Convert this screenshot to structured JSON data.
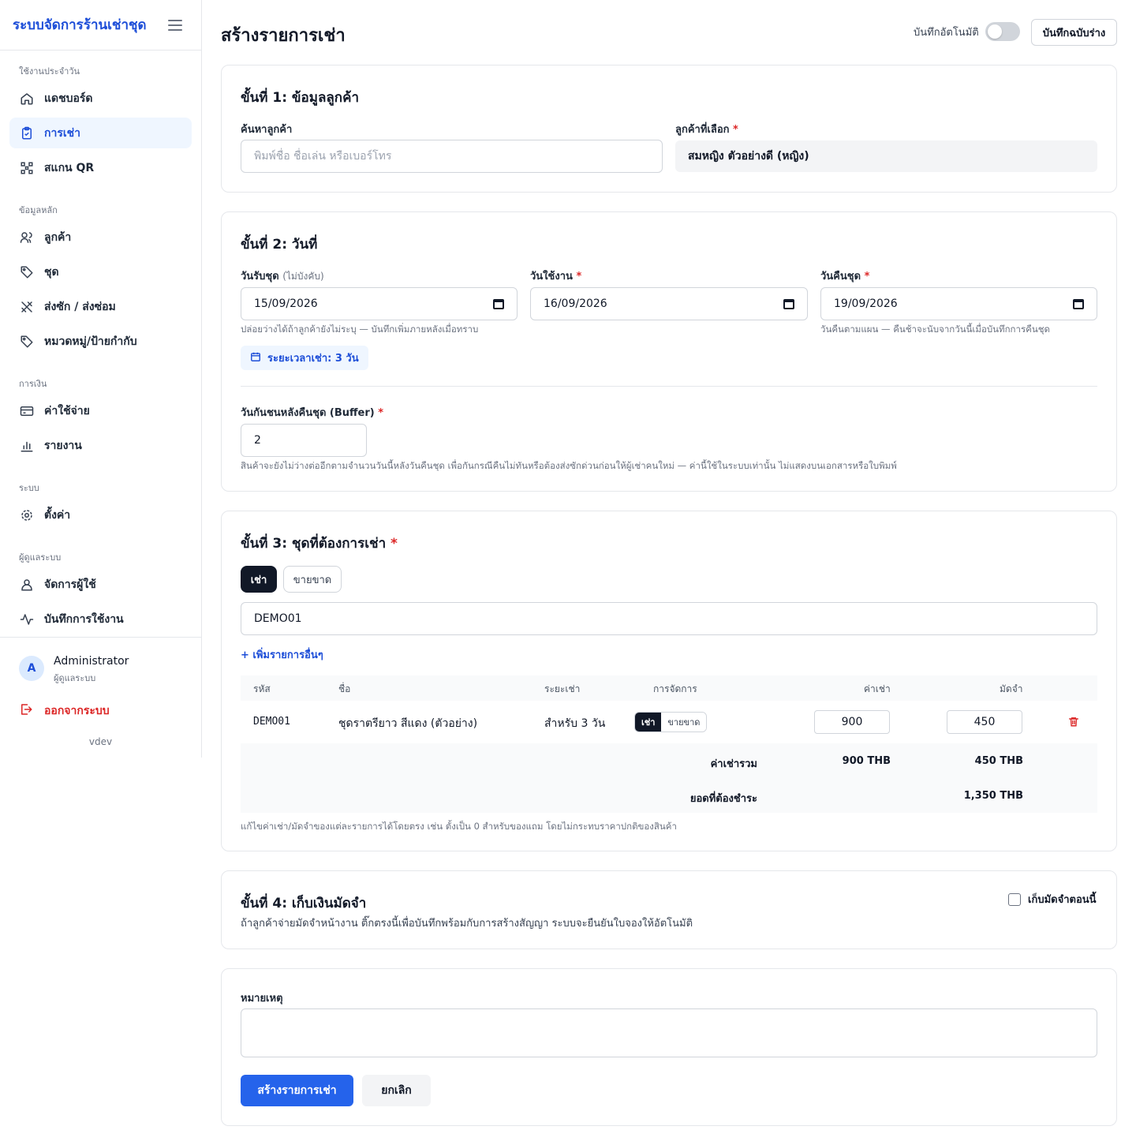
{
  "sidebar": {
    "brand": "ระบบจัดการร้านเช่าชุด",
    "sections": {
      "daily": "ใช้งานประจำวัน",
      "master": "ข้อมูลหลัก",
      "finance": "การเงิน",
      "system": "ระบบ",
      "admin": "ผู้ดูแลระบบ"
    },
    "items": {
      "dashboard": "แดชบอร์ด",
      "rentals": "การเช่า",
      "scan_qr": "สแกน QR",
      "customers": "ลูกค้า",
      "outfits": "ชุด",
      "laundry": "ส่งซัก / ส่งซ่อม",
      "categories": "หมวดหมู่/ป้ายกำกับ",
      "expenses": "ค่าใช้จ่าย",
      "reports": "รายงาน",
      "settings": "ตั้งค่า",
      "users": "จัดการผู้ใช้",
      "activity_log": "บันทึกการใช้งาน"
    },
    "user": {
      "initial": "A",
      "name": "Administrator",
      "role": "ผู้ดูแลระบบ"
    },
    "logout": "ออกจากระบบ",
    "version": "vdev"
  },
  "header": {
    "title": "สร้างรายการเช่า",
    "autosave_label": "บันทึกอัตโนมัติ",
    "autosave_on": false,
    "save_draft": "บันทึกฉบับร่าง"
  },
  "step1": {
    "title": "ขั้นที่ 1: ข้อมูลลูกค้า",
    "search_label": "ค้นหาลูกค้า",
    "search_placeholder": "พิมพ์ชื่อ ชื่อเล่น หรือเบอร์โทร",
    "selected_label": "ลูกค้าที่เลือก",
    "selected_value": "สมหญิง ตัวอย่างดี (หญิง)"
  },
  "step2": {
    "title": "ขั้นที่ 2: วันที่",
    "pickup_label": "วันรับชุด",
    "pickup_optional": "(ไม่บังคับ)",
    "pickup_value": "15/09/2026",
    "pickup_hint": "ปล่อยว่างได้ถ้าลูกค้ายังไม่ระบุ — บันทึกเพิ่มภายหลังเมื่อทราบ",
    "use_label": "วันใช้งาน",
    "use_value": "16/09/2026",
    "return_label": "วันคืนชุด",
    "return_value": "19/09/2026",
    "return_hint": "วันคืนตามแผน — คืนช้าจะนับจากวันนี้เมื่อบันทึกการคืนชุด",
    "duration_badge": "ระยะเวลาเช่า: 3 วัน",
    "buffer_label": "วันกันชนหลังคืนชุด (Buffer)",
    "buffer_value": "2",
    "buffer_hint": "สินค้าจะยังไม่ว่างต่ออีกตามจำนวนวันนี้หลังวันคืนชุด เพื่อกันกรณีคืนไม่ทันหรือต้องส่งซักด่วนก่อนให้ผู้เช่าคนใหม่ — ค่านี้ใช้ในระบบเท่านั้น ไม่แสดงบนเอกสารหรือใบพิมพ์"
  },
  "step3": {
    "title": "ขั้นที่ 3: ชุดที่ต้องการเช่า",
    "mode_rent": "เช่า",
    "mode_sell": "ขายขาด",
    "code_value": "DEMO01",
    "add_more": "+ เพิ่มรายการอื่นๆ",
    "columns": {
      "code": "รหัส",
      "name": "ชื่อ",
      "period": "ระยะเช่า",
      "manage": "การจัดการ",
      "rent": "ค่าเช่า",
      "deposit": "มัดจำ"
    },
    "rows": [
      {
        "code": "DEMO01",
        "name": "ชุดราตรียาว สีแดง (ตัวอย่าง)",
        "period": "สำหรับ 3 วัน",
        "mode_rent": "เช่า",
        "mode_sell": "ขายขาด",
        "rent": "900",
        "deposit": "450"
      }
    ],
    "total_rent_label": "ค่าเช่ารวม",
    "total_rent": "900 THB",
    "total_deposit": "450 THB",
    "amount_due_label": "ยอดที่ต้องชำระ",
    "amount_due": "1,350 THB",
    "note": "แก้ไขค่าเช่า/มัดจำของแต่ละรายการได้โดยตรง เช่น ตั้งเป็น 0 สำหรับของแถม โดยไม่กระทบราคาปกติของสินค้า"
  },
  "step4": {
    "title": "ขั้นที่ 4: เก็บเงินมัดจำ",
    "checkbox_label": "เก็บมัดจำตอนนี้",
    "checked": false,
    "description": "ถ้าลูกค้าจ่ายมัดจำหน้างาน ติ๊กตรงนี้เพื่อบันทึกพร้อมกับการสร้างสัญญา ระบบจะยืนยันใบจองให้อัตโนมัติ"
  },
  "notes": {
    "label": "หมายเหตุ",
    "value": "",
    "submit": "สร้างรายการเช่า",
    "cancel": "ยกเลิก"
  },
  "colors": {
    "accent": "#2563eb",
    "brand": "#1d4ed8",
    "danger": "#dc2626",
    "dark": "#111827"
  },
  "icons": [
    "home-icon",
    "clipboard-icon",
    "qr-icon",
    "users-icon",
    "tag-icon",
    "tools-icon",
    "tag-icon",
    "card-icon",
    "bar-chart-icon",
    "gear-icon",
    "user-icon",
    "activity-icon",
    "logout-icon",
    "calendar-icon",
    "trash-icon",
    "menu-icon"
  ]
}
